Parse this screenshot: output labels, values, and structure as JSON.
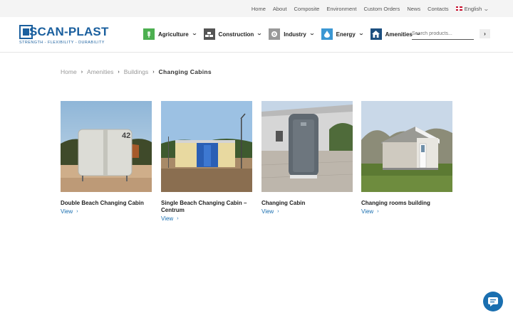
{
  "topnav": {
    "links": [
      "Home",
      "About",
      "Composite",
      "Environment",
      "Custom Orders",
      "News",
      "Contacts"
    ],
    "language": "English"
  },
  "logo": {
    "name": "SCAN-PLAST",
    "tagline": "STRENGTH - FLEXIBILITY - DURABILITY"
  },
  "mainnav": {
    "items": [
      {
        "label": "Agriculture",
        "icon": "wheat-icon",
        "color": "#4caf50"
      },
      {
        "label": "Construction",
        "icon": "bricks-icon",
        "color": "#555555"
      },
      {
        "label": "Industry",
        "icon": "gear-icon",
        "color": "#999999"
      },
      {
        "label": "Energy",
        "icon": "drop-icon",
        "color": "#3b97d3"
      },
      {
        "label": "Amenities",
        "icon": "house-icon",
        "color": "#1c4f7f"
      }
    ]
  },
  "search": {
    "placeholder": "Search products..."
  },
  "breadcrumb": {
    "items": [
      "Home",
      "Amenities",
      "Buildings"
    ],
    "current": "Changing Cabins"
  },
  "products": [
    {
      "title": "Double Beach Changing Cabin",
      "link": "View"
    },
    {
      "title": "Single Beach Changing Cabin – Centrum",
      "link": "View"
    },
    {
      "title": "Changing Cabin",
      "link": "View"
    },
    {
      "title": "Changing rooms building",
      "link": "View"
    }
  ],
  "product_images": [
    {
      "label": "42"
    }
  ],
  "colors": {
    "brand": "#1a5f9e",
    "link": "#1a6fb0",
    "topbar": "#f4f4f4"
  }
}
